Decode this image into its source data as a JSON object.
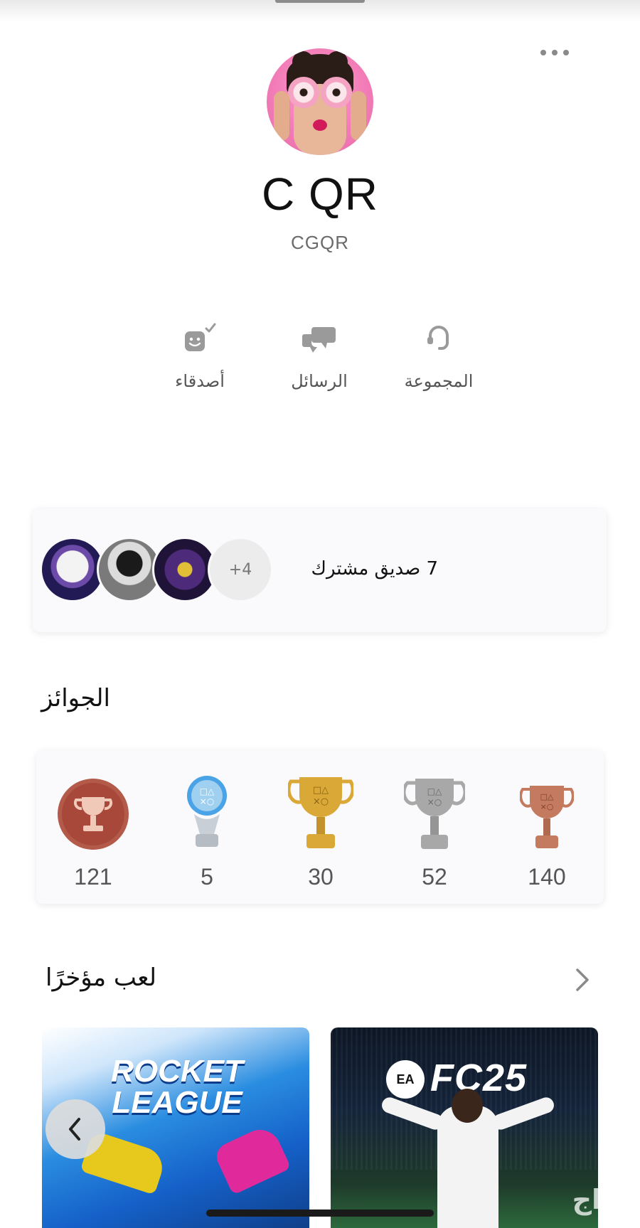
{
  "profile": {
    "display_name": "C QR",
    "online_id": "CGQR"
  },
  "actions": {
    "friends_label": "أصدقاء",
    "messages_label": "الرسائل",
    "group_label": "المجموعة"
  },
  "mutual_friends": {
    "more_count": "+4",
    "text": "7 صديق مشترك"
  },
  "trophies": {
    "title": "الجوائز",
    "items": [
      {
        "type": "trophy-level",
        "count": "121"
      },
      {
        "type": "platinum",
        "count": "5"
      },
      {
        "type": "gold",
        "count": "30"
      },
      {
        "type": "silver",
        "count": "52"
      },
      {
        "type": "bronze",
        "count": "140"
      }
    ],
    "colors": {
      "platinum": "#9fd0f0",
      "gold": "#d9a836",
      "silver": "#a8a8a8",
      "bronze": "#c47a5e",
      "level": "#a7483a"
    }
  },
  "recently_played": {
    "title": "لعب مؤخرًا",
    "games": [
      {
        "name_line1": "ROCKET",
        "name_line2": "LEAGUE"
      },
      {
        "publisher": "EA",
        "name": "FC25"
      }
    ]
  },
  "watermark": "حراج"
}
